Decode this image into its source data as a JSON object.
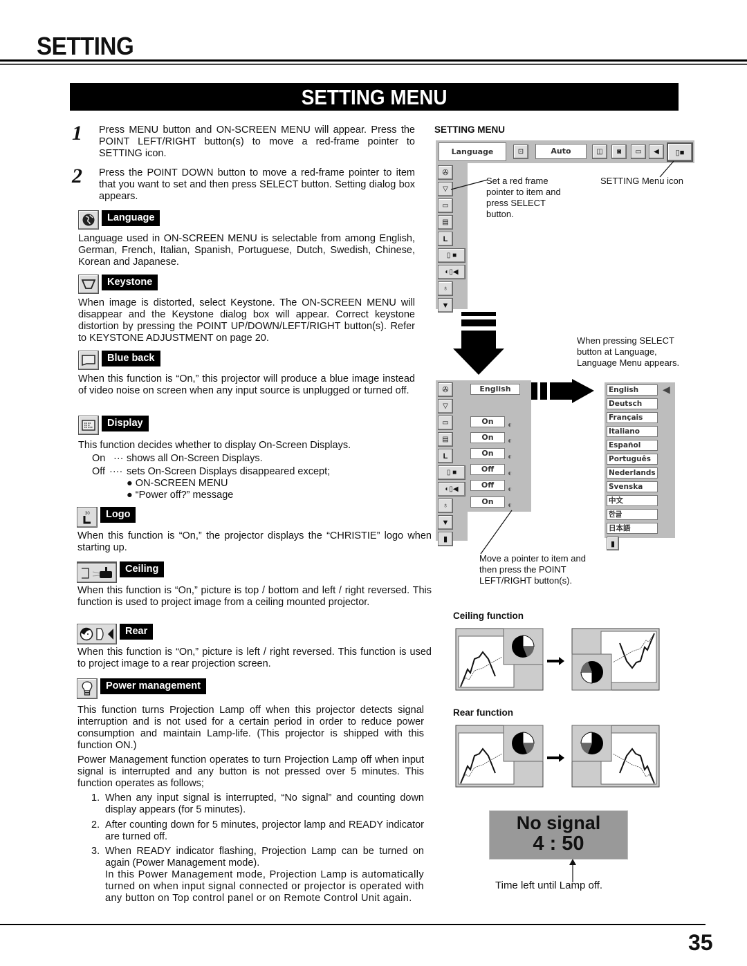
{
  "page": {
    "title": "SETTING",
    "banner": "SETTING MENU",
    "page_number": "35"
  },
  "steps": [
    {
      "num": "1",
      "text": "Press MENU button and ON-SCREEN MENU will appear.  Press the POINT LEFT/RIGHT button(s) to move a red-frame pointer to  SETTING icon."
    },
    {
      "num": "2",
      "text": "Press the POINT DOWN button to move a red-frame pointer to item that you want to set and then press SELECT button. Setting dialog box appears."
    }
  ],
  "sections": {
    "language": {
      "label": "Language",
      "icon": "globe-icon",
      "text": "Language used in ON-SCREEN MENU is selectable from among English, German, French, Italian, Spanish, Portuguese, Dutch, Swedish, Chinese, Korean and Japanese."
    },
    "keystone": {
      "label": "Keystone",
      "icon": "keystone-icon",
      "text": "When image is distorted, select Keystone. The ON-SCREEN MENU will disappear and the Keystone dialog box will appear. Correct keystone distortion by pressing the POINT UP/DOWN/LEFT/RIGHT button(s). Refer to KEYSTONE ADJUSTMENT on page 20."
    },
    "blue_back": {
      "label": "Blue back",
      "icon": "screen-icon",
      "text": "When this function is “On,” this projector will produce a blue image instead of video noise on screen when any input source is unplugged or turned off."
    },
    "display": {
      "label": "Display",
      "icon": "display-icon",
      "text": "This function decides whether to display On-Screen Displays.",
      "on_key": "On",
      "on_dots": "···",
      "on_text": "shows all On-Screen Displays.",
      "off_key": "Off",
      "off_dots": "····",
      "off_text": "sets On-Screen Displays disappeared except;",
      "bullets": [
        "ON-SCREEN MENU",
        "“Power off?” message"
      ]
    },
    "logo": {
      "label": "Logo",
      "icon": "logo-icon",
      "icon_text": "30",
      "text": "When this function is “On,” the projector displays the “CHRISTIE” logo when starting up."
    },
    "ceiling": {
      "label": "Ceiling",
      "icon": "ceiling-projector-icon",
      "text": "When this function is “On,” picture is top / bottom and left / right reversed.  This function is used to project image from a ceiling mounted projector."
    },
    "rear": {
      "label": "Rear",
      "icon": "rear-projector-icon",
      "text": "When this function is “On,” picture is left / right reversed.  This function is used to project image to a rear projection screen."
    },
    "power": {
      "label": "Power management",
      "icon": "lamp-icon",
      "text1": "This function turns Projection Lamp off when this projector detects signal interruption and is not used for a certain period in order to reduce power consumption and maintain Lamp-life.  (This projector is shipped with this function ON.)",
      "text2": "Power Management function operates to turn Projection Lamp off when input signal is interrupted and any button is not pressed over 5 minutes. This function operates as follows;",
      "list": [
        {
          "n": "1.",
          "t": "When any input signal is interrupted, “No signal” and counting down display appears (for 5 minutes)."
        },
        {
          "n": "2.",
          "t": "After counting down for 5 minutes, projector lamp and READY indicator are turned off."
        },
        {
          "n": "3.",
          "t": "When READY indicator flashing, Projection Lamp can be turned on again (Power Management mode).",
          "t2": "In this Power Management mode, Projection Lamp is automatically turned on when input signal connected or projector is operated with any button on Top control panel or on Remote Control Unit again."
        }
      ]
    }
  },
  "right": {
    "heading": "SETTING MENU",
    "topbar": {
      "field": "Language",
      "mode": "Auto"
    },
    "note_red_frame": "Set a red frame pointer to item and press SELECT button.",
    "note_menu_icon": "SETTING Menu icon",
    "note_select": "When pressing SELECT button at Language, Language Menu appears.",
    "note_pointer": "Move a pointer to item and then press the POINT LEFT/RIGHT button(s).",
    "values": [
      "English",
      "On",
      "On",
      "On",
      "Off",
      "Off",
      "On"
    ],
    "languages": [
      "English",
      "Deutsch",
      "Français",
      "Italiano",
      "Español",
      "Português",
      "Nederlands",
      "Svenska",
      "中文",
      "한글",
      "日本語"
    ],
    "ceiling_title": "Ceiling function",
    "rear_title": "Rear function",
    "nosignal": {
      "title": "No signal",
      "time": "4 : 50"
    },
    "time_caption": "Time left until Lamp off."
  }
}
